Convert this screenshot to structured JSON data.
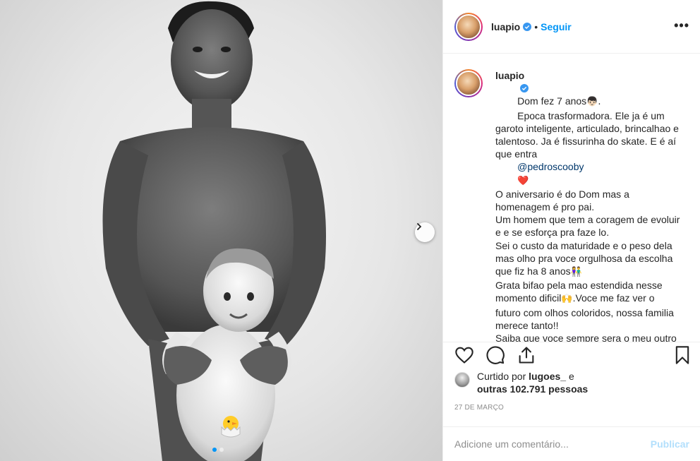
{
  "post": {
    "username": "luapio",
    "follow_label": "Seguir",
    "separator": "•",
    "more_label": "•••"
  },
  "caption": {
    "username": "luapio",
    "line1": "Dom fez 7 anos",
    "line1_emoji": "👦🏻.",
    "body1": "Epoca trasformadora. Ele ja é um garoto inteligente, articulado, brincalhao e talentoso. Ja é fissurinha do skate. E é aí que entra",
    "mention": "@pedroscooby",
    "mention_emoji": "❤️",
    "body2": "O aniversario é do Dom mas a homenagem é pro pai.\nUm homem que tem a coragem de evoluir e e se esforça pra faze lo.\nSei o custo da maturidade e o peso dela mas olho pra voce orgulhosa da escolha que fiz ha 8 anos",
    "body2_emoji": "👫",
    "body3": "Grata bifao pela mao estendida nesse momento dificil",
    "body3_emoji": "🙌",
    "body4": ".Voce me faz ver o futuro com olhos coloridos, nossa familia merece tanto!!\nSaiba que voce sempre sera o meu outro lado da força e sempre sera meu"
  },
  "likes": {
    "prefix": "Curtido por",
    "user": "lugoes_",
    "conj": "e",
    "others": "outras 102.791 pessoas"
  },
  "date": "27 DE MARÇO",
  "comment_box": {
    "placeholder": "Adicione um comentário...",
    "publish_label": "Publicar"
  },
  "colors": {
    "accent": "#0095f6",
    "publish_disabled": "#b2dffc",
    "mention": "#00376b",
    "like_heart": "#ed4956"
  },
  "icons": {
    "verified": "verified-badge-icon",
    "like": "heart-icon",
    "comment": "comment-bubble-icon",
    "share": "share-icon",
    "save": "bookmark-icon",
    "next": "chevron-right-icon",
    "sticker": "hatching-chick-sticker"
  },
  "carousel": {
    "total_slides": 2,
    "current_slide": 1
  }
}
